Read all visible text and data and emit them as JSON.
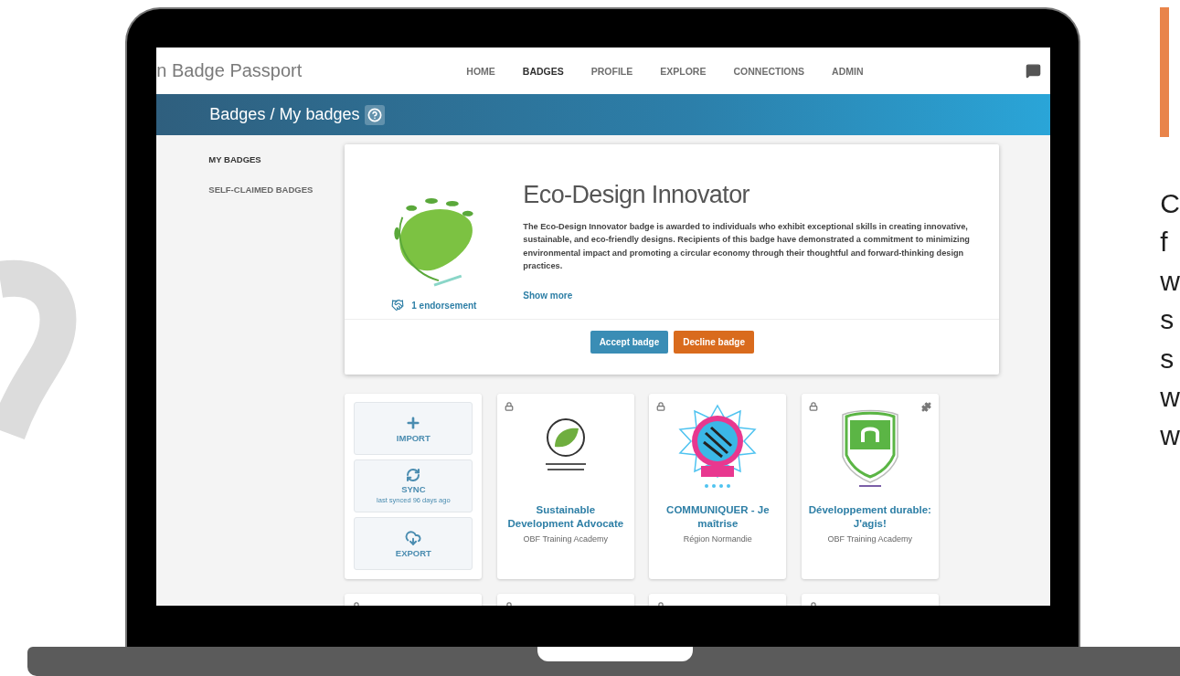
{
  "brand": "n Badge Passport",
  "nav": [
    {
      "label": "HOME",
      "selected": false
    },
    {
      "label": "BADGES",
      "selected": true
    },
    {
      "label": "PROFILE",
      "selected": false
    },
    {
      "label": "EXPLORE",
      "selected": false
    },
    {
      "label": "CONNECTIONS",
      "selected": false
    },
    {
      "label": "ADMIN",
      "selected": false
    }
  ],
  "page_title": "Badges / My badges",
  "sidebar": [
    {
      "label": "MY BADGES",
      "selected": true
    },
    {
      "label": "SELF-CLAIMED BADGES",
      "selected": false
    }
  ],
  "pending_badge": {
    "kind": "eco",
    "title": "Eco-Design Innovator",
    "description": "The Eco-Design Innovator badge is awarded to individuals who exhibit exceptional skills in creating innovative, sustainable, and eco-friendly designs. Recipients of this badge have demonstrated a commitment to minimizing environmental impact and promoting a circular economy through their thoughtful and forward-thinking design practices.",
    "endorsements": "1 endorsement",
    "show_more": "Show more",
    "buttons": [
      {
        "label": "Accept badge",
        "kind": "accept"
      },
      {
        "label": "Decline badge",
        "kind": "decline"
      }
    ]
  },
  "actions": [
    {
      "label": "IMPORT",
      "kind": "import"
    },
    {
      "label": "SYNC",
      "kind": "sync",
      "note": "last synced 96 days ago"
    },
    {
      "label": "EXPORT",
      "kind": "export"
    }
  ],
  "badges": [
    {
      "name": "Sustainable Development Advocate",
      "issuer": "OBF Training Academy",
      "kind": "leaf",
      "plugin": false
    },
    {
      "name": "COMMUNIQUER - Je maîtrise",
      "issuer": "Région Normandie",
      "kind": "star",
      "plugin": false
    },
    {
      "name": "Développement durable: J'agis!",
      "issuer": "OBF Training Academy",
      "kind": "shield",
      "plugin": true
    }
  ],
  "side_text": [
    "C",
    "f",
    "w",
    "s",
    "s",
    "w",
    "w"
  ]
}
